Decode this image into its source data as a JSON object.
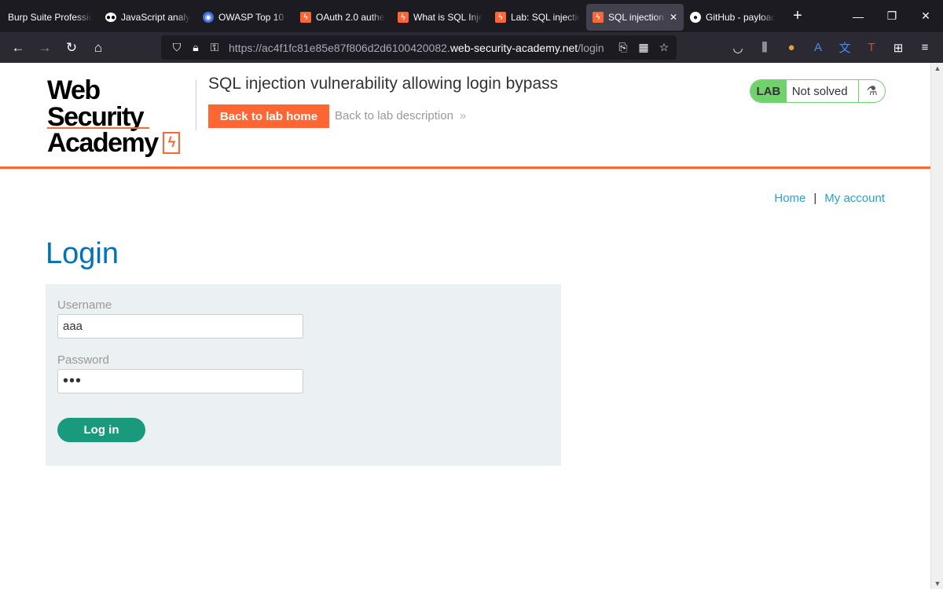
{
  "browser": {
    "tabs": [
      {
        "title": "Burp Suite Professio",
        "icon": "none"
      },
      {
        "title": "JavaScript analys",
        "icon": "medium-icon"
      },
      {
        "title": "OWASP Top 10 fo",
        "icon": "owasp-icon"
      },
      {
        "title": "OAuth 2.0 authe",
        "icon": "burp-icon"
      },
      {
        "title": "What is SQL Injec",
        "icon": "burp-icon"
      },
      {
        "title": "Lab: SQL injection",
        "icon": "burp-icon"
      },
      {
        "title": "SQL injection v",
        "icon": "burp-icon",
        "active": true
      },
      {
        "title": "GitHub - payload",
        "icon": "github-icon"
      }
    ],
    "url_prefix": "https://ac4f1fc81e85e87f806d2d6100420082.",
    "url_host": "web-security-academy.net",
    "url_path": "/login"
  },
  "header": {
    "logo_line1": "Web Security",
    "logo_line2": "Academy",
    "lab_title": "SQL injection vulnerability allowing login bypass",
    "back_home_label": "Back to lab home",
    "back_desc_label": "Back to lab description",
    "lab_tag": "LAB",
    "lab_state": "Not solved"
  },
  "nav": {
    "home": "Home",
    "separator": "|",
    "my_account": "My account"
  },
  "login": {
    "heading": "Login",
    "username_label": "Username",
    "username_value": "aaa",
    "password_label": "Password",
    "password_value": "•••",
    "submit_label": "Log in"
  },
  "colors": {
    "brand_orange": "#ff6633",
    "heading_blue": "#0071bc",
    "lab_green": "#70d16d",
    "button_teal": "#1a9a7d"
  }
}
